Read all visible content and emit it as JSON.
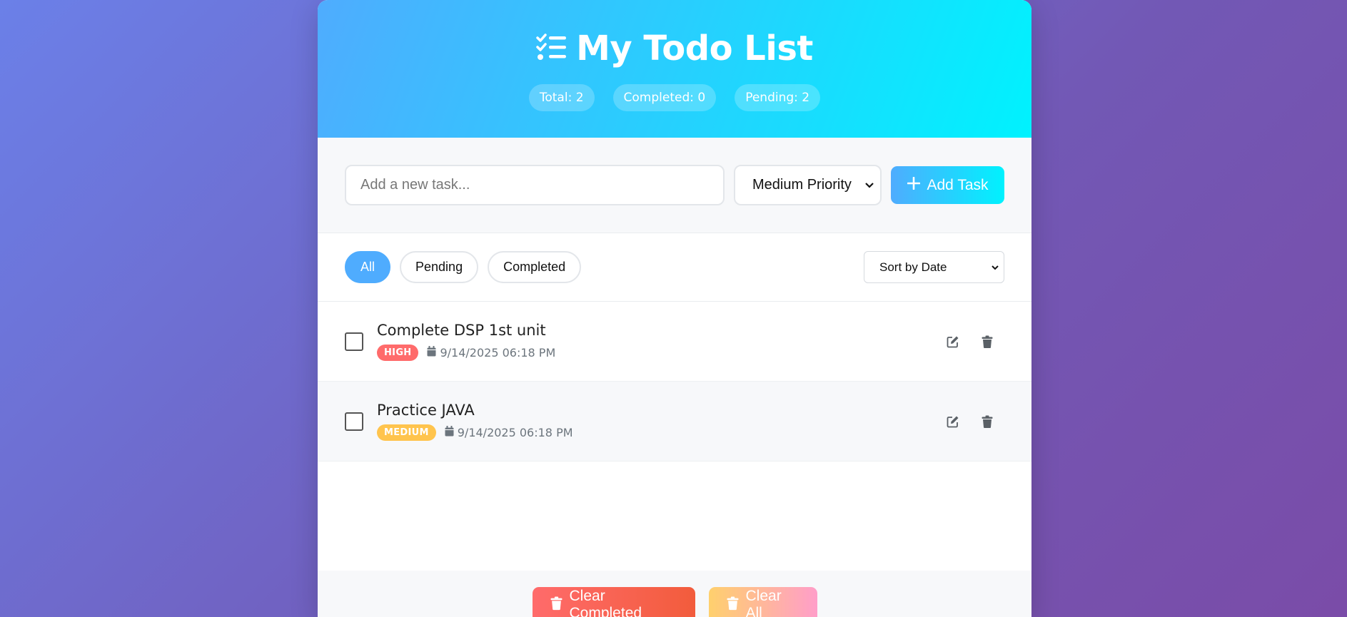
{
  "header": {
    "title": "My Todo List",
    "stats": {
      "total": "Total: 2",
      "completed": "Completed: 0",
      "pending": "Pending: 2"
    }
  },
  "input": {
    "placeholder": "Add a new task...",
    "priority_selected": "Medium Priority",
    "add_label": "Add Task"
  },
  "filters": {
    "all": "All",
    "pending": "Pending",
    "completed": "Completed",
    "active": "All",
    "sort_selected": "Sort by Date"
  },
  "todos": [
    {
      "text": "Complete DSP 1st unit",
      "priority": "HIGH",
      "priority_color": "#ff6b6b",
      "date": "9/14/2025 06:18 PM",
      "completed": false
    },
    {
      "text": "Practice JAVA",
      "priority": "MEDIUM",
      "priority_color": "#ffc44d",
      "date": "9/14/2025 06:18 PM",
      "completed": false
    }
  ],
  "footer": {
    "clear_completed": "Clear Completed",
    "clear_all": "Clear All"
  },
  "colors": {
    "accent_start": "#4facfe",
    "accent_end": "#00f2fe",
    "danger": "#ff6b6b"
  }
}
